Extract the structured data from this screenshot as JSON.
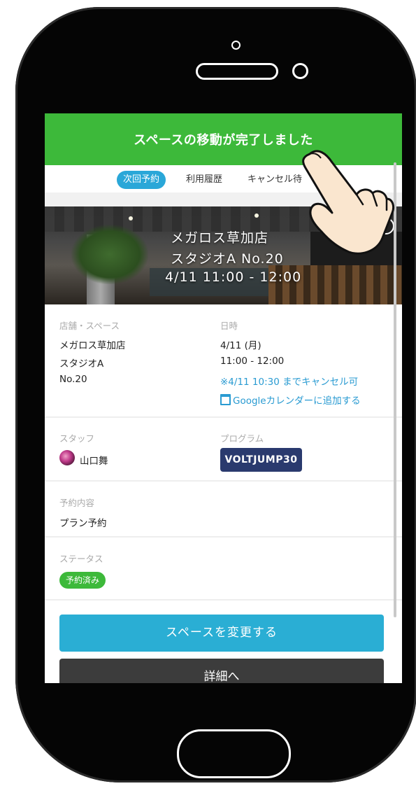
{
  "toast": {
    "message": "スペースの移動が完了しました"
  },
  "tabs": [
    {
      "label": "次回予約",
      "active": true
    },
    {
      "label": "利用履歴",
      "active": false
    },
    {
      "label": "キャンセル待",
      "active": false
    }
  ],
  "hero": {
    "store": "メガロス草加店",
    "space": "スタジオA No.20",
    "datetime": "4/11  11:00 - 12:00",
    "help_icon": "question-circle-icon"
  },
  "details": {
    "store_label": "店舗・スペース",
    "store_name": "メガロス草加店",
    "studio": "スタジオA",
    "number": "No.20",
    "date_label": "日時",
    "date": "4/11 (月)",
    "time": "11:00 - 12:00",
    "cancel_note": "※4/11 10:30 までキャンセル可",
    "calendar_link": "Googleカレンダーに追加する",
    "staff_label": "スタッフ",
    "staff_name": "山口舞",
    "program_label": "プログラム",
    "program": "VOLTJUMP30",
    "content_label": "予約内容",
    "content": "プラン予約",
    "status_label": "ステータス",
    "status": "予約済み"
  },
  "buttons": {
    "change_space": "スペースを変更する",
    "details": "詳細へ"
  },
  "colors": {
    "toast_green": "#3db93a",
    "tab_active": "#2aa7d8",
    "primary_button": "#2aaed4",
    "program_badge": "#2a3a6e",
    "link_blue": "#2a9bd2"
  }
}
